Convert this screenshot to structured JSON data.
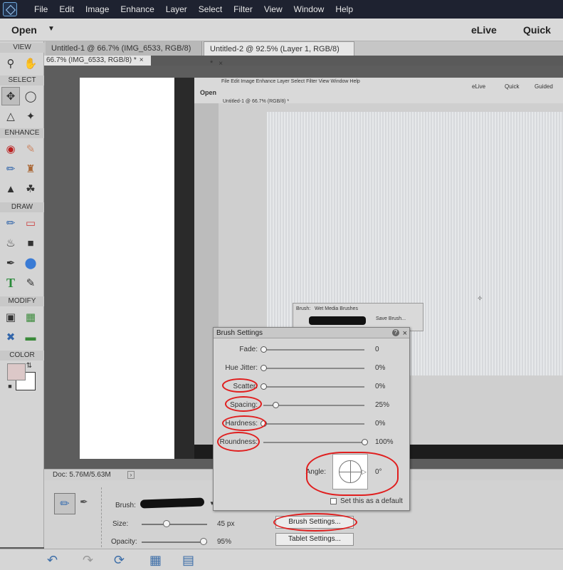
{
  "menu": {
    "items": [
      "File",
      "Edit",
      "Image",
      "Enhance",
      "Layer",
      "Select",
      "Filter",
      "View",
      "Window",
      "Help"
    ]
  },
  "topbar": {
    "open_label": "Open",
    "elive_label": "eLive",
    "quick_label": "Quick"
  },
  "toolbox": {
    "sections": {
      "view": "VIEW",
      "select": "SELECT",
      "enhance": "ENHANCE",
      "draw": "DRAW",
      "modify": "MODIFY",
      "color": "COLOR"
    },
    "foreground_color": "#dcc8c8",
    "background_color": "#ffffff"
  },
  "tabs": [
    {
      "label": "Untitled-1 @ 66.7% (IMG_6533, RGB/8) *",
      "close": "×",
      "active": false
    },
    {
      "label": "Untitled-2 @ 92.5% (Layer 1, RGB/8) *",
      "close": "×",
      "active": true
    }
  ],
  "subtab": {
    "label": "66.7% (IMG_6533, RGB/8) *",
    "close": "×"
  },
  "photo_text": {
    "menu": "File  Edit  Image  Enhance  Layer  Select  Filter  View  Window  Help",
    "open": "Open",
    "elive": "eLive",
    "quick": "Quick",
    "guided": "Guided",
    "tab": "Untitled-1 @ 66.7% (RGB/8) *",
    "brush_label": "Brush:",
    "brush_set": "Wet Media Brushes",
    "save_brush": "Save Brush..."
  },
  "status": {
    "doc": "Doc: 5.76M/5.63M",
    "arrow": "›"
  },
  "options": {
    "brush_label": "Brush:",
    "size_label": "Size:",
    "size_value": "45 px",
    "size_fraction": 0.38,
    "opacity_label": "Opacity:",
    "opacity_value": "95%",
    "opacity_fraction": 0.95,
    "brush_settings_button": "Brush Settings...",
    "tablet_settings_button": "Tablet Settings..."
  },
  "dialog": {
    "title": "Brush Settings",
    "help": "?",
    "close": "×",
    "rows": [
      {
        "label": "Fade:",
        "value": "0",
        "fraction": 0.0
      },
      {
        "label": "Hue Jitter:",
        "value": "0%",
        "fraction": 0.0
      },
      {
        "label": "Scatter:",
        "value": "0%",
        "fraction": 0.0
      },
      {
        "label": "Spacing:",
        "value": "25%",
        "fraction": 0.12
      },
      {
        "label": "Hardness:",
        "value": "0%",
        "fraction": 0.0
      },
      {
        "label": "Roundness:",
        "value": "100%",
        "fraction": 1.0
      }
    ],
    "angle_label": "Angle:",
    "angle_value": "0°",
    "default_checkbox_label": "Set this as a default",
    "default_checked": false
  },
  "annotation_color": "#e01e1e"
}
